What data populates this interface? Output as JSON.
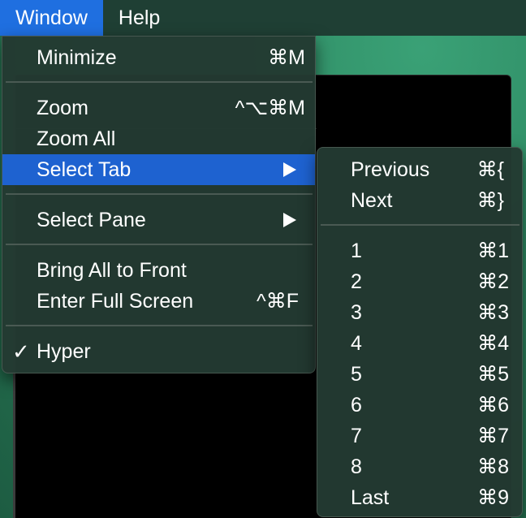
{
  "menubar": {
    "items": [
      {
        "label": "Window",
        "active": true
      },
      {
        "label": "Help",
        "active": false
      }
    ]
  },
  "window_menu": {
    "items": [
      {
        "label": "Minimize",
        "shortcut": "⌘M"
      },
      {
        "label": "Zoom",
        "shortcut": "^⌥⌘M"
      },
      {
        "label": "Zoom All",
        "shortcut": ""
      },
      {
        "label": "Select Tab",
        "shortcut": "",
        "has_submenu": true,
        "highlighted": true
      },
      {
        "label": "Select Pane",
        "shortcut": "",
        "has_submenu": true
      },
      {
        "label": "Bring All to Front",
        "shortcut": ""
      },
      {
        "label": "Enter Full Screen",
        "shortcut": "^⌘F"
      },
      {
        "label": "Hyper",
        "checked": true,
        "check_glyph": "✓"
      }
    ]
  },
  "select_tab_submenu": {
    "items": [
      {
        "label": "Previous",
        "shortcut": "⌘{"
      },
      {
        "label": "Next",
        "shortcut": "⌘}"
      },
      {
        "label": "1",
        "shortcut": "⌘1"
      },
      {
        "label": "2",
        "shortcut": "⌘2"
      },
      {
        "label": "3",
        "shortcut": "⌘3"
      },
      {
        "label": "4",
        "shortcut": "⌘4"
      },
      {
        "label": "5",
        "shortcut": "⌘5"
      },
      {
        "label": "6",
        "shortcut": "⌘6"
      },
      {
        "label": "7",
        "shortcut": "⌘7"
      },
      {
        "label": "8",
        "shortcut": "⌘8"
      },
      {
        "label": "Last",
        "shortcut": "⌘9"
      }
    ]
  },
  "colors": {
    "menubar_bg": "#1f3f34",
    "highlight": "#1e62d0",
    "menu_bg": "#233a32",
    "terminal_bg": "#000000"
  }
}
